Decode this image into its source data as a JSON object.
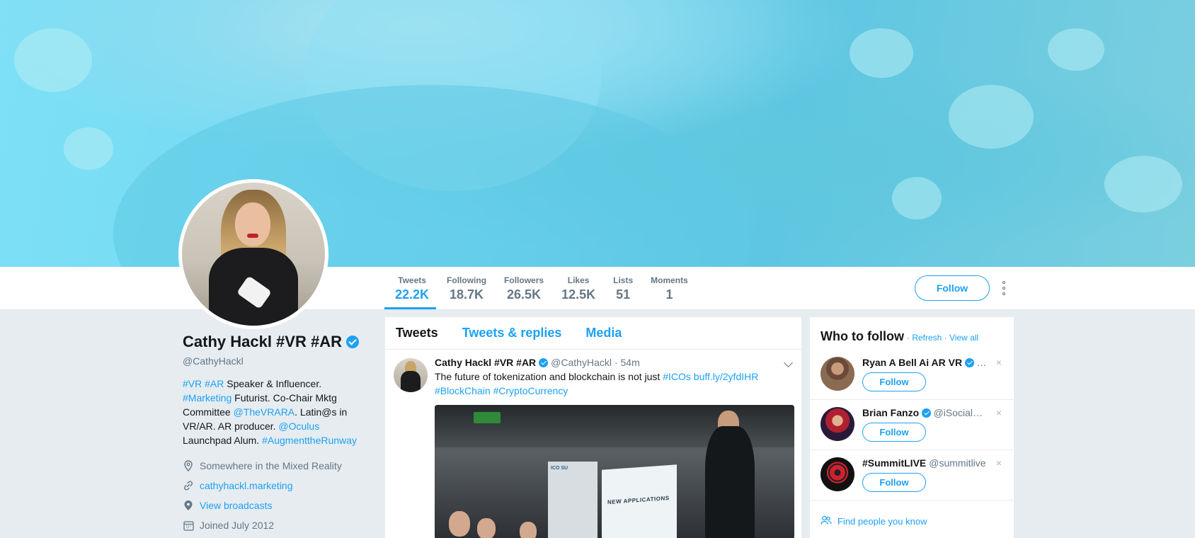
{
  "profile": {
    "name": "Cathy Hackl #VR #AR",
    "handle": "@CathyHackl",
    "bio": [
      {
        "t": "#VR",
        "link": true
      },
      {
        "t": " ",
        "link": false
      },
      {
        "t": "#AR",
        "link": true
      },
      {
        "t": " Speaker & Influencer. ",
        "link": false
      },
      {
        "t": "#Marketing",
        "link": true
      },
      {
        "t": " Futurist. Co-Chair Mktg Committee ",
        "link": false
      },
      {
        "t": "@TheVRARA",
        "link": true
      },
      {
        "t": ". Latin@s in VR/AR. AR producer. ",
        "link": false
      },
      {
        "t": "@Oculus",
        "link": true
      },
      {
        "t": " Launchpad Alum. ",
        "link": false
      },
      {
        "t": "#AugmenttheRunway",
        "link": true
      }
    ],
    "location": "Somewhere in the Mixed Reality",
    "website": "cathyhackl.marketing",
    "broadcasts": "View broadcasts",
    "joined": "Joined July 2012"
  },
  "stats": [
    {
      "label": "Tweets",
      "value": "22.2K",
      "active": true
    },
    {
      "label": "Following",
      "value": "18.7K",
      "active": false
    },
    {
      "label": "Followers",
      "value": "26.5K",
      "active": false
    },
    {
      "label": "Likes",
      "value": "12.5K",
      "active": false
    },
    {
      "label": "Lists",
      "value": "51",
      "active": false
    },
    {
      "label": "Moments",
      "value": "1",
      "active": false
    }
  ],
  "navbar": {
    "follow_label": "Follow"
  },
  "timeline": {
    "tabs": [
      "Tweets",
      "Tweets & replies",
      "Media"
    ],
    "tweet": {
      "name": "Cathy Hackl #VR #AR",
      "handle": "@CathyHackl",
      "time": "· 54m",
      "text": [
        {
          "t": "The future of tokenization and blockchain is not just ",
          "link": false
        },
        {
          "t": "#ICOs",
          "link": true
        },
        {
          "t": " ",
          "link": false
        },
        {
          "t": "buff.ly/2yfdIHR",
          "link": true
        },
        {
          "t": " ",
          "link": false
        },
        {
          "t": "#BlockChain",
          "link": true
        },
        {
          "t": " ",
          "link": false
        },
        {
          "t": "#CryptoCurrency",
          "link": true
        }
      ],
      "media": {
        "screen_title": "NEW APPLICATIONS",
        "banner_text": "ICO SU"
      }
    }
  },
  "who_to_follow": {
    "title": "Who to follow",
    "refresh": "Refresh",
    "view_all": "View all",
    "separator": "·",
    "items": [
      {
        "name": "Ryan A Bell Ai AR VR",
        "handle": "…",
        "verified": true,
        "follow_label": "Follow",
        "close": "×"
      },
      {
        "name": "Brian Fanzo",
        "handle": "@iSocialF…",
        "verified": true,
        "follow_label": "Follow",
        "close": "×"
      },
      {
        "name": "#SummitLIVE",
        "handle": "@summitlive",
        "verified": false,
        "follow_label": "Follow",
        "close": "×"
      }
    ],
    "find_people": "Find people you know"
  },
  "colors": {
    "accent": "#1da1f2",
    "text": "#14171a",
    "muted": "#657786",
    "background": "#e6ecf0"
  }
}
